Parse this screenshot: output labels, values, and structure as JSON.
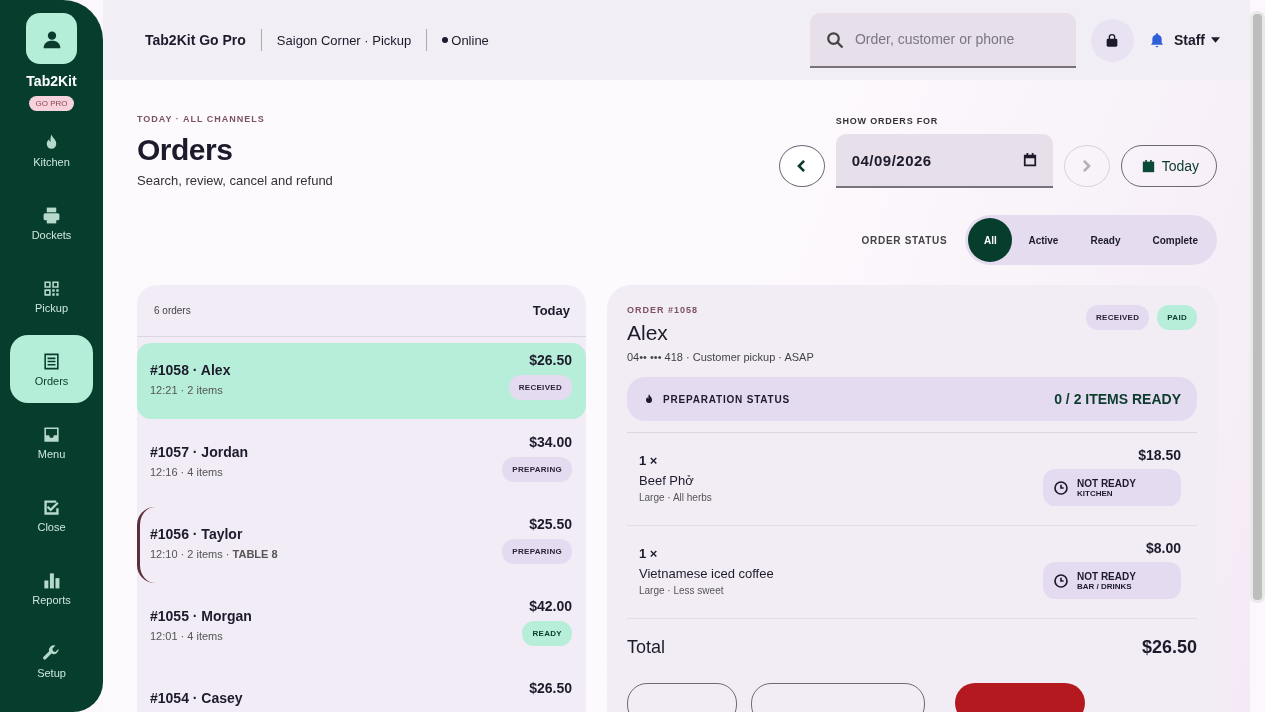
{
  "sidebar": {
    "brand": "Tab2Kit",
    "plan_badge": "GO PRO",
    "items": [
      {
        "label": "Kitchen",
        "selected": false
      },
      {
        "label": "Dockets",
        "selected": false
      },
      {
        "label": "Pickup",
        "selected": false
      },
      {
        "label": "Orders",
        "selected": true
      },
      {
        "label": "Menu",
        "selected": false
      },
      {
        "label": "Close",
        "selected": false
      },
      {
        "label": "Reports",
        "selected": false
      },
      {
        "label": "Setup",
        "selected": false
      }
    ]
  },
  "topbar": {
    "app_name": "Tab2Kit Go Pro",
    "location": "Saigon Corner · Pickup",
    "connection": "Online",
    "search": {
      "placeholder": "Order, customer or phone"
    },
    "user": "Staff"
  },
  "header": {
    "eyebrow": "TODAY · ALL CHANNELS",
    "title": "Orders",
    "subtitle": "Search, review, cancel and refund"
  },
  "date_picker": {
    "label": "SHOW ORDERS FOR",
    "value": "04/09/2026",
    "next_disabled": true,
    "today_button": "Today"
  },
  "status_filter": {
    "label": "ORDER STATUS",
    "options": [
      {
        "label": "All",
        "selected": true
      },
      {
        "label": "Active",
        "selected": false
      },
      {
        "label": "Ready",
        "selected": false
      },
      {
        "label": "Complete",
        "selected": false
      }
    ]
  },
  "order_list": {
    "count": "6 orders",
    "period": "Today",
    "rows": [
      {
        "title": "#1058 · Alex",
        "meta": "12:21 · 2 items",
        "amount": "$26.50",
        "status": "RECEIVED",
        "kind": "pending",
        "selected": true,
        "flagged": false
      },
      {
        "title": "#1057 · Jordan",
        "meta": "12:16 · 4 items",
        "amount": "$34.00",
        "status": "PREPARING",
        "kind": "pending",
        "selected": false,
        "flagged": false
      },
      {
        "title": "#1056 · Taylor",
        "meta": "12:10 · 2 items · **TABLE 8**",
        "amount": "$25.50",
        "status": "PREPARING",
        "kind": "pending",
        "selected": false,
        "flagged": true
      },
      {
        "title": "#1055 · Morgan",
        "meta": "12:01 · 4 items",
        "amount": "$42.00",
        "status": "READY",
        "kind": "done",
        "selected": false,
        "flagged": false
      },
      {
        "title": "#1054 · Casey",
        "amount": "$26.50",
        "selected": false,
        "flagged": false
      }
    ]
  },
  "order_detail": {
    "eyebrow": "ORDER #1058",
    "customer": "Alex",
    "meta": "04•• ••• 418 · Customer pickup · ASAP",
    "badges": [
      {
        "label": "RECEIVED",
        "kind": "pending"
      },
      {
        "label": "PAID",
        "kind": "done"
      }
    ],
    "prep_status": {
      "label": "PREPARATION STATUS",
      "value": "0 / 2 ITEMS READY"
    },
    "items": [
      {
        "qty": "1 ×",
        "name": "Beef Phở",
        "options": "Large · All herbs",
        "price": "$18.50",
        "state": "NOT READY",
        "station": "KITCHEN"
      },
      {
        "qty": "1 ×",
        "name": "Vietnamese iced coffee",
        "options": "Large · Less sweet",
        "price": "$8.00",
        "state": "NOT READY",
        "station": "BAR / DRINKS"
      }
    ],
    "total_label": "Total",
    "total": "$26.50",
    "actions": [
      {
        "kind": "outline"
      },
      {
        "kind": "outline"
      },
      {
        "kind": "danger"
      }
    ]
  }
}
